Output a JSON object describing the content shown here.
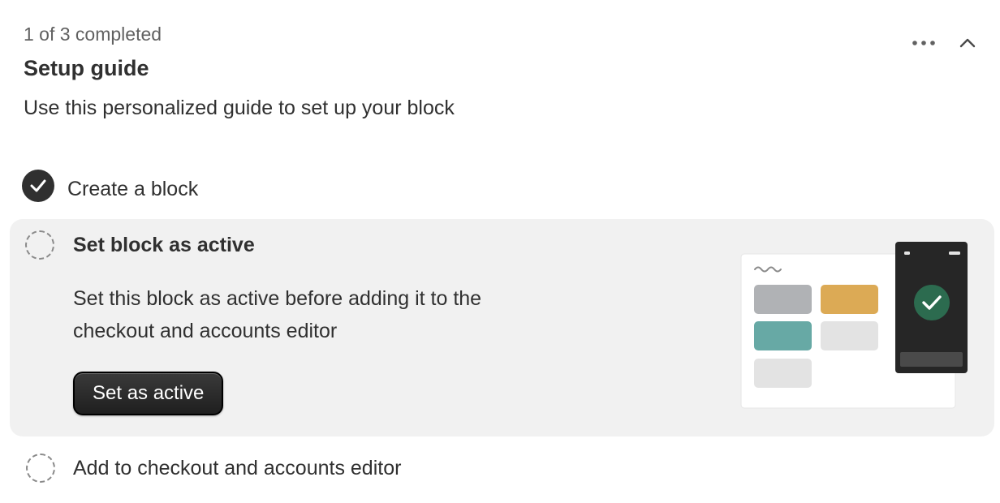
{
  "header": {
    "progress": "1 of 3 completed",
    "title": "Setup guide",
    "subtitle": "Use this personalized guide to set up your block",
    "more_icon": "ellipsis-icon",
    "collapse_icon": "chevron-up-icon"
  },
  "steps": [
    {
      "label": "Create a block",
      "completed": true
    },
    {
      "label": "Set block as active",
      "completed": false,
      "description": "Set this block as active before adding it to the checkout and accounts editor",
      "button_label": "Set as active"
    },
    {
      "label": "Add to checkout and accounts editor",
      "completed": false
    }
  ],
  "colors": {
    "background": "#ffffff",
    "active_step_bg": "#f1f1f1",
    "primary": "#303030",
    "illustration_gold": "#dcaa55",
    "illustration_teal": "#67a9a5",
    "illustration_gray": "#b0b2b5",
    "illustration_light": "#e3e3e3",
    "phone_bg": "#262626",
    "success_green": "#2c6b4f"
  }
}
